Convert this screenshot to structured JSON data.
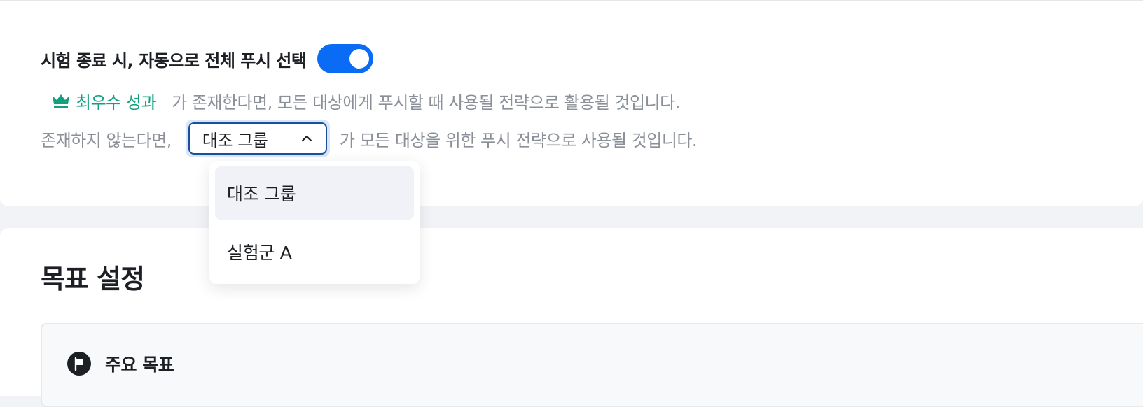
{
  "auto_push": {
    "toggle_label": "시험 종료 시, 자동으로 전체 푸시 선택",
    "enabled": true,
    "accent_color": "#0a6cf5"
  },
  "description": {
    "best_chip_label": "최우수 성과",
    "best_chip_icon": "crown-icon",
    "best_chip_color": "#12a07e",
    "line1_text": "가 존재한다면, 모든 대상에게 푸시할 때 사용될 전략으로 활용될 것입니다.",
    "line2_prefix": "존재하지 않는다면,",
    "line2_suffix": "가 모든 대상을 위한 푸시 전략으로 사용될 것입니다."
  },
  "fallback_select": {
    "selected_value": "대조 그룹",
    "icon": "chevron-up-icon",
    "open": true,
    "options": [
      {
        "label": "대조 그룹",
        "selected": true
      },
      {
        "label": "실험군 A",
        "selected": false
      }
    ]
  },
  "goal_section": {
    "title": "목표 설정",
    "primary_goal_label": "주요 목표",
    "primary_goal_icon": "flag-icon"
  }
}
